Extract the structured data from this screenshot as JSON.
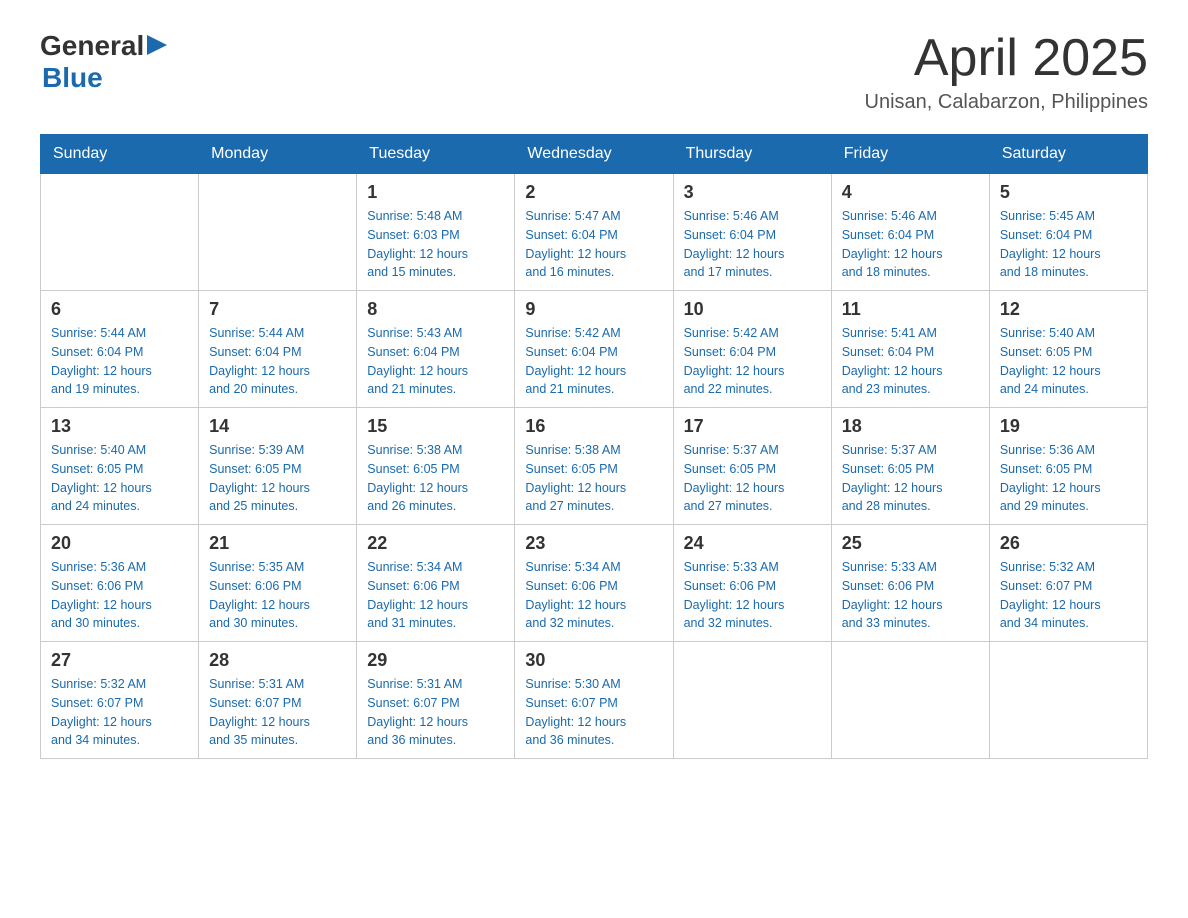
{
  "header": {
    "logo": {
      "general": "General",
      "arrow": "▶",
      "blue": "Blue"
    },
    "title": "April 2025",
    "subtitle": "Unisan, Calabarzon, Philippines"
  },
  "weekdays": [
    "Sunday",
    "Monday",
    "Tuesday",
    "Wednesday",
    "Thursday",
    "Friday",
    "Saturday"
  ],
  "weeks": [
    [
      {
        "day": "",
        "info": ""
      },
      {
        "day": "",
        "info": ""
      },
      {
        "day": "1",
        "info": "Sunrise: 5:48 AM\nSunset: 6:03 PM\nDaylight: 12 hours\nand 15 minutes."
      },
      {
        "day": "2",
        "info": "Sunrise: 5:47 AM\nSunset: 6:04 PM\nDaylight: 12 hours\nand 16 minutes."
      },
      {
        "day": "3",
        "info": "Sunrise: 5:46 AM\nSunset: 6:04 PM\nDaylight: 12 hours\nand 17 minutes."
      },
      {
        "day": "4",
        "info": "Sunrise: 5:46 AM\nSunset: 6:04 PM\nDaylight: 12 hours\nand 18 minutes."
      },
      {
        "day": "5",
        "info": "Sunrise: 5:45 AM\nSunset: 6:04 PM\nDaylight: 12 hours\nand 18 minutes."
      }
    ],
    [
      {
        "day": "6",
        "info": "Sunrise: 5:44 AM\nSunset: 6:04 PM\nDaylight: 12 hours\nand 19 minutes."
      },
      {
        "day": "7",
        "info": "Sunrise: 5:44 AM\nSunset: 6:04 PM\nDaylight: 12 hours\nand 20 minutes."
      },
      {
        "day": "8",
        "info": "Sunrise: 5:43 AM\nSunset: 6:04 PM\nDaylight: 12 hours\nand 21 minutes."
      },
      {
        "day": "9",
        "info": "Sunrise: 5:42 AM\nSunset: 6:04 PM\nDaylight: 12 hours\nand 21 minutes."
      },
      {
        "day": "10",
        "info": "Sunrise: 5:42 AM\nSunset: 6:04 PM\nDaylight: 12 hours\nand 22 minutes."
      },
      {
        "day": "11",
        "info": "Sunrise: 5:41 AM\nSunset: 6:04 PM\nDaylight: 12 hours\nand 23 minutes."
      },
      {
        "day": "12",
        "info": "Sunrise: 5:40 AM\nSunset: 6:05 PM\nDaylight: 12 hours\nand 24 minutes."
      }
    ],
    [
      {
        "day": "13",
        "info": "Sunrise: 5:40 AM\nSunset: 6:05 PM\nDaylight: 12 hours\nand 24 minutes."
      },
      {
        "day": "14",
        "info": "Sunrise: 5:39 AM\nSunset: 6:05 PM\nDaylight: 12 hours\nand 25 minutes."
      },
      {
        "day": "15",
        "info": "Sunrise: 5:38 AM\nSunset: 6:05 PM\nDaylight: 12 hours\nand 26 minutes."
      },
      {
        "day": "16",
        "info": "Sunrise: 5:38 AM\nSunset: 6:05 PM\nDaylight: 12 hours\nand 27 minutes."
      },
      {
        "day": "17",
        "info": "Sunrise: 5:37 AM\nSunset: 6:05 PM\nDaylight: 12 hours\nand 27 minutes."
      },
      {
        "day": "18",
        "info": "Sunrise: 5:37 AM\nSunset: 6:05 PM\nDaylight: 12 hours\nand 28 minutes."
      },
      {
        "day": "19",
        "info": "Sunrise: 5:36 AM\nSunset: 6:05 PM\nDaylight: 12 hours\nand 29 minutes."
      }
    ],
    [
      {
        "day": "20",
        "info": "Sunrise: 5:36 AM\nSunset: 6:06 PM\nDaylight: 12 hours\nand 30 minutes."
      },
      {
        "day": "21",
        "info": "Sunrise: 5:35 AM\nSunset: 6:06 PM\nDaylight: 12 hours\nand 30 minutes."
      },
      {
        "day": "22",
        "info": "Sunrise: 5:34 AM\nSunset: 6:06 PM\nDaylight: 12 hours\nand 31 minutes."
      },
      {
        "day": "23",
        "info": "Sunrise: 5:34 AM\nSunset: 6:06 PM\nDaylight: 12 hours\nand 32 minutes."
      },
      {
        "day": "24",
        "info": "Sunrise: 5:33 AM\nSunset: 6:06 PM\nDaylight: 12 hours\nand 32 minutes."
      },
      {
        "day": "25",
        "info": "Sunrise: 5:33 AM\nSunset: 6:06 PM\nDaylight: 12 hours\nand 33 minutes."
      },
      {
        "day": "26",
        "info": "Sunrise: 5:32 AM\nSunset: 6:07 PM\nDaylight: 12 hours\nand 34 minutes."
      }
    ],
    [
      {
        "day": "27",
        "info": "Sunrise: 5:32 AM\nSunset: 6:07 PM\nDaylight: 12 hours\nand 34 minutes."
      },
      {
        "day": "28",
        "info": "Sunrise: 5:31 AM\nSunset: 6:07 PM\nDaylight: 12 hours\nand 35 minutes."
      },
      {
        "day": "29",
        "info": "Sunrise: 5:31 AM\nSunset: 6:07 PM\nDaylight: 12 hours\nand 36 minutes."
      },
      {
        "day": "30",
        "info": "Sunrise: 5:30 AM\nSunset: 6:07 PM\nDaylight: 12 hours\nand 36 minutes."
      },
      {
        "day": "",
        "info": ""
      },
      {
        "day": "",
        "info": ""
      },
      {
        "day": "",
        "info": ""
      }
    ]
  ]
}
